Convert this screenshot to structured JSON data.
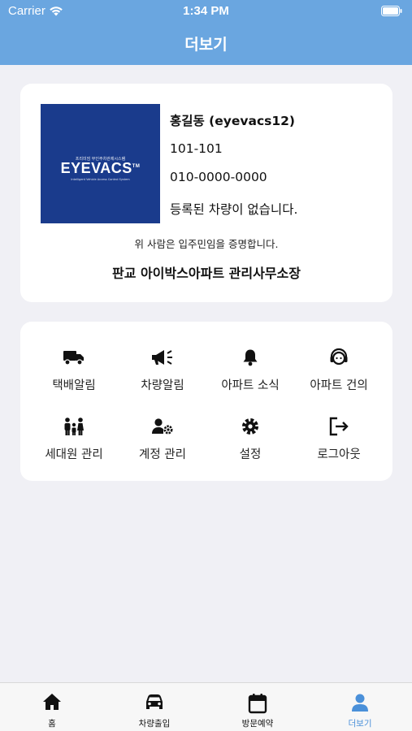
{
  "status_bar": {
    "carrier": "Carrier",
    "time": "1:34 PM"
  },
  "header": {
    "title": "더보기"
  },
  "profile": {
    "logo_small_text": "프리미엄 무인주차관제시스템",
    "logo_text": "EYEVACS",
    "logo_tm": "TM",
    "logo_subtext": "Intelligent Vehicle Access Control System",
    "name": "홍길동 (eyevacs12)",
    "unit": "101-101",
    "phone": "010-0000-0000",
    "vehicle_status": "등록된 차량이 없습니다.",
    "certification": "위 사람은 입주민임을 증명합니다.",
    "office": "판교 아이박스아파트 관리사무소장"
  },
  "menu": {
    "items": [
      {
        "label": "택배알림",
        "icon": "truck-icon"
      },
      {
        "label": "차량알림",
        "icon": "megaphone-icon"
      },
      {
        "label": "아파트 소식",
        "icon": "bell-icon"
      },
      {
        "label": "아파트 건의",
        "icon": "headset-icon"
      },
      {
        "label": "세대원 관리",
        "icon": "family-icon"
      },
      {
        "label": "계정 관리",
        "icon": "user-gear-icon"
      },
      {
        "label": "설정",
        "icon": "gear-icon"
      },
      {
        "label": "로그아웃",
        "icon": "logout-icon"
      }
    ]
  },
  "tabbar": {
    "tabs": [
      {
        "label": "홈",
        "icon": "home-icon"
      },
      {
        "label": "차량출입",
        "icon": "car-icon"
      },
      {
        "label": "방문예약",
        "icon": "calendar-icon"
      },
      {
        "label": "더보기",
        "icon": "person-icon"
      }
    ],
    "active_index": 3
  },
  "colors": {
    "header": "#6aa6e0",
    "logo_background": "#1a3b8c",
    "tab_active": "#4a90d9",
    "page_background": "#f0f0f5"
  }
}
